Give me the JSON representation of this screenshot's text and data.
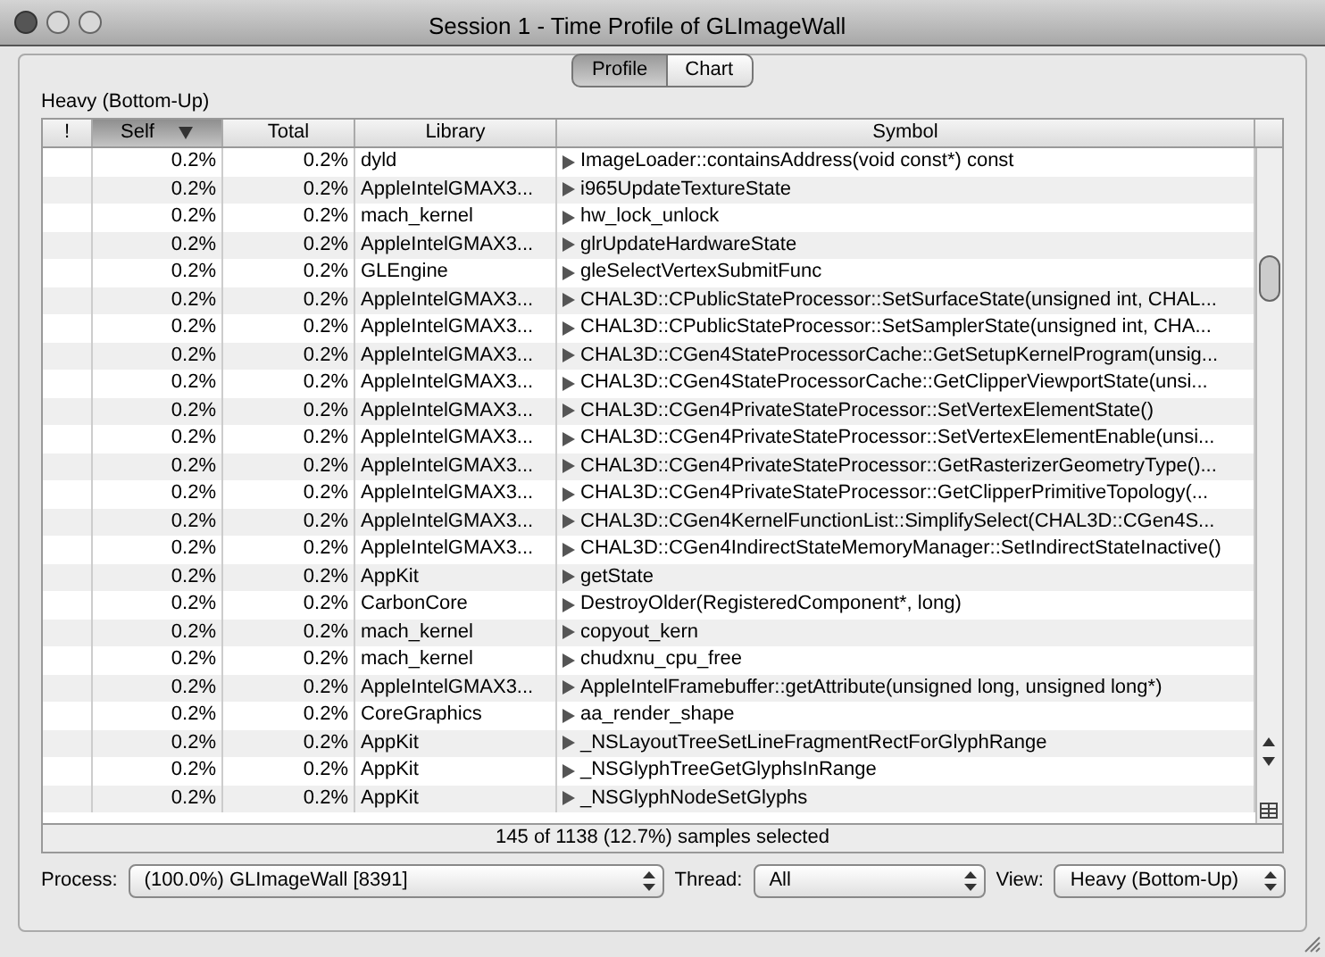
{
  "window": {
    "title": "Session 1 - Time Profile of GLImageWall"
  },
  "tabs": [
    {
      "label": "Profile",
      "selected": true
    },
    {
      "label": "Chart",
      "selected": false
    }
  ],
  "view_label": "Heavy (Bottom-Up)",
  "table": {
    "columns": [
      {
        "label": "!",
        "selected": false
      },
      {
        "label": "Self",
        "selected": true
      },
      {
        "label": "Total",
        "selected": false
      },
      {
        "label": "Library",
        "selected": false
      },
      {
        "label": "Symbol",
        "selected": false
      }
    ],
    "rows": [
      {
        "self": "0.2%",
        "total": "0.2%",
        "library": "dyld",
        "symbol": "ImageLoader::containsAddress(void const*) const"
      },
      {
        "self": "0.2%",
        "total": "0.2%",
        "library": "AppleIntelGMAX3...",
        "symbol": "i965UpdateTextureState"
      },
      {
        "self": "0.2%",
        "total": "0.2%",
        "library": "mach_kernel",
        "symbol": "hw_lock_unlock"
      },
      {
        "self": "0.2%",
        "total": "0.2%",
        "library": "AppleIntelGMAX3...",
        "symbol": "glrUpdateHardwareState"
      },
      {
        "self": "0.2%",
        "total": "0.2%",
        "library": "GLEngine",
        "symbol": "gleSelectVertexSubmitFunc"
      },
      {
        "self": "0.2%",
        "total": "0.2%",
        "library": "AppleIntelGMAX3...",
        "symbol": "CHAL3D::CPublicStateProcessor::SetSurfaceState(unsigned int, CHAL..."
      },
      {
        "self": "0.2%",
        "total": "0.2%",
        "library": "AppleIntelGMAX3...",
        "symbol": "CHAL3D::CPublicStateProcessor::SetSamplerState(unsigned int, CHA..."
      },
      {
        "self": "0.2%",
        "total": "0.2%",
        "library": "AppleIntelGMAX3...",
        "symbol": "CHAL3D::CGen4StateProcessorCache::GetSetupKernelProgram(unsig..."
      },
      {
        "self": "0.2%",
        "total": "0.2%",
        "library": "AppleIntelGMAX3...",
        "symbol": "CHAL3D::CGen4StateProcessorCache::GetClipperViewportState(unsi..."
      },
      {
        "self": "0.2%",
        "total": "0.2%",
        "library": "AppleIntelGMAX3...",
        "symbol": "CHAL3D::CGen4PrivateStateProcessor::SetVertexElementState()"
      },
      {
        "self": "0.2%",
        "total": "0.2%",
        "library": "AppleIntelGMAX3...",
        "symbol": "CHAL3D::CGen4PrivateStateProcessor::SetVertexElementEnable(unsi..."
      },
      {
        "self": "0.2%",
        "total": "0.2%",
        "library": "AppleIntelGMAX3...",
        "symbol": "CHAL3D::CGen4PrivateStateProcessor::GetRasterizerGeometryType()..."
      },
      {
        "self": "0.2%",
        "total": "0.2%",
        "library": "AppleIntelGMAX3...",
        "symbol": "CHAL3D::CGen4PrivateStateProcessor::GetClipperPrimitiveTopology(..."
      },
      {
        "self": "0.2%",
        "total": "0.2%",
        "library": "AppleIntelGMAX3...",
        "symbol": "CHAL3D::CGen4KernelFunctionList::SimplifySelect(CHAL3D::CGen4S..."
      },
      {
        "self": "0.2%",
        "total": "0.2%",
        "library": "AppleIntelGMAX3...",
        "symbol": "CHAL3D::CGen4IndirectStateMemoryManager::SetIndirectStateInactive()"
      },
      {
        "self": "0.2%",
        "total": "0.2%",
        "library": "AppKit",
        "symbol": "getState"
      },
      {
        "self": "0.2%",
        "total": "0.2%",
        "library": "CarbonCore",
        "symbol": "DestroyOlder(RegisteredComponent*, long)"
      },
      {
        "self": "0.2%",
        "total": "0.2%",
        "library": "mach_kernel",
        "symbol": "copyout_kern"
      },
      {
        "self": "0.2%",
        "total": "0.2%",
        "library": "mach_kernel",
        "symbol": "chudxnu_cpu_free"
      },
      {
        "self": "0.2%",
        "total": "0.2%",
        "library": "AppleIntelGMAX3...",
        "symbol": "AppleIntelFramebuffer::getAttribute(unsigned long, unsigned long*)"
      },
      {
        "self": "0.2%",
        "total": "0.2%",
        "library": "CoreGraphics",
        "symbol": "aa_render_shape"
      },
      {
        "self": "0.2%",
        "total": "0.2%",
        "library": "AppKit",
        "symbol": "_NSLayoutTreeSetLineFragmentRectForGlyphRange"
      },
      {
        "self": "0.2%",
        "total": "0.2%",
        "library": "AppKit",
        "symbol": "_NSGlyphTreeGetGlyphsInRange"
      },
      {
        "self": "0.2%",
        "total": "0.2%",
        "library": "AppKit",
        "symbol": "_NSGlyphNodeSetGlyphs"
      }
    ]
  },
  "status": "145 of 1138 (12.7%) samples selected",
  "filters": [
    {
      "label": "Process:",
      "value": "(100.0%) GLImageWall [8391]"
    },
    {
      "label": "Thread:",
      "value": "All"
    },
    {
      "label": "View:",
      "value": "Heavy (Bottom-Up)"
    }
  ]
}
